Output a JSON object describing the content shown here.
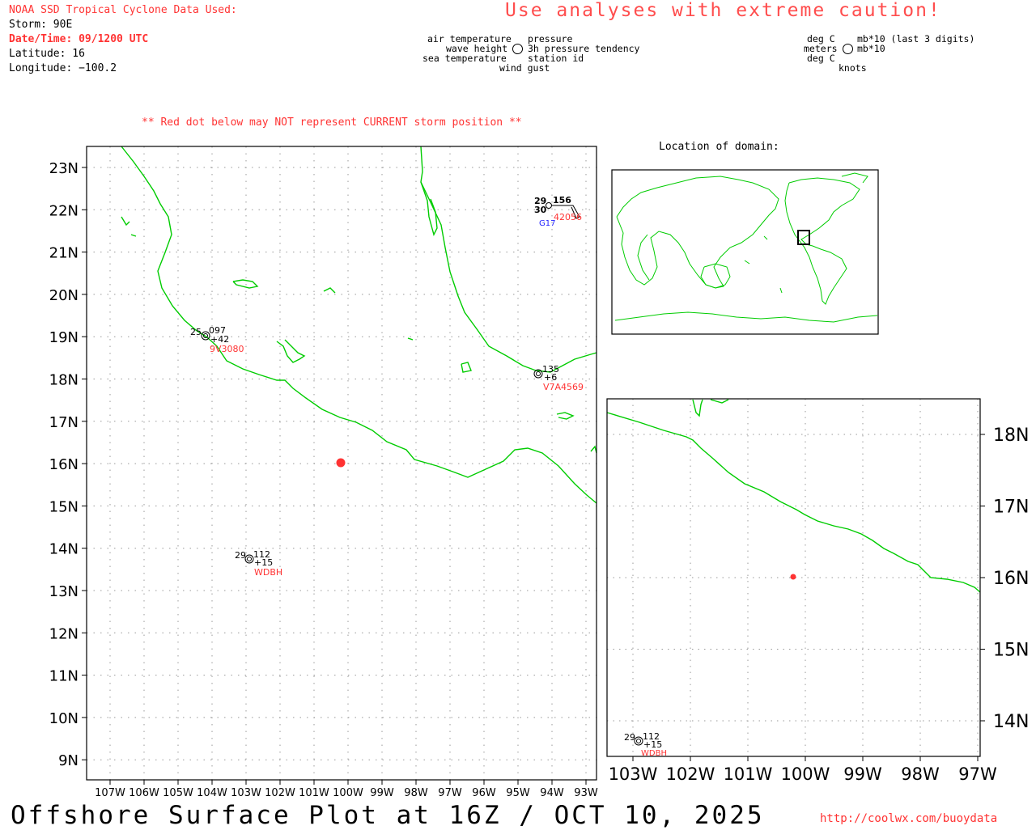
{
  "header": {
    "source": "NOAA SSD Tropical Cyclone Data Used:",
    "storm": "Storm: 90E",
    "datetime": "Date/Time: 09/1200 UTC",
    "latitude": "Latitude: 16",
    "longitude": "Longitude: −100.2"
  },
  "caution": "Use analyses with extreme caution!",
  "legend": {
    "air_temperature": "air temperature",
    "pressure": "pressure",
    "wave_height": "wave height",
    "pressure_tendency": "3h pressure tendency",
    "sea_temperature": "sea temperature",
    "station_id": "station id",
    "wind_gust": "wind gust",
    "units_degc_1": "deg C",
    "units_mb": "mb*10 (last 3 digits)",
    "units_meters": "meters",
    "units_mb2": "mb*10",
    "units_degc_2": "deg C",
    "units_knots": "knots"
  },
  "warning": "** Red dot below may NOT represent CURRENT storm position **",
  "location_title": "Location of domain:",
  "main_map": {
    "lat_labels": [
      "23N",
      "22N",
      "21N",
      "20N",
      "19N",
      "18N",
      "17N",
      "16N",
      "15N",
      "14N",
      "13N",
      "12N",
      "11N",
      "10N",
      "9N"
    ],
    "lon_labels": [
      "107W",
      "106W",
      "105W",
      "104W",
      "103W",
      "102W",
      "101W",
      "100W",
      "99W",
      "98W",
      "97W",
      "96W",
      "95W",
      "94W",
      "93W"
    ]
  },
  "stations": [
    {
      "id": "9V3080",
      "air": "25",
      "pres": "097",
      "tend": "+42"
    },
    {
      "id": "V7A4569",
      "air": "",
      "pres": "135",
      "tend": "+6"
    },
    {
      "id": "WDBH",
      "air": "29",
      "pres": "112",
      "tend": "+15"
    },
    {
      "id": "42056",
      "air": "29",
      "sea": "30",
      "pres": "156",
      "gust": "G17"
    }
  ],
  "zoom_map": {
    "lat_labels": [
      "18N",
      "17N",
      "16N",
      "15N",
      "14N"
    ],
    "lon_labels": [
      "103W",
      "102W",
      "101W",
      "100W",
      "99W",
      "98W",
      "97W"
    ]
  },
  "footer": {
    "title": "Offshore Surface Plot at 16Z / OCT 10, 2025",
    "url": "http://coolwx.com/buoydata"
  },
  "colors": {
    "coast": "#00cc00",
    "storm": "#ff3333",
    "station_id": "#ff3333",
    "gust": "#2222ff"
  }
}
